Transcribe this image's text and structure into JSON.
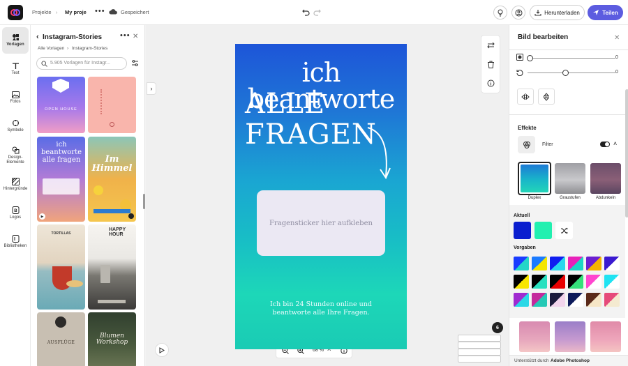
{
  "topbar": {
    "breadcrumb_projects": "Projekte",
    "project_name": "My proje",
    "saved_status": "Gespeichert",
    "download_label": "Herunterladen",
    "share_label": "Teilen",
    "share_color": "#5c5ce0"
  },
  "rail": {
    "items": [
      {
        "label": "Vorlagen",
        "icon": "templates-icon"
      },
      {
        "label": "Text",
        "icon": "text-icon"
      },
      {
        "label": "Fotos",
        "icon": "photos-icon"
      },
      {
        "label": "Symbole",
        "icon": "symbols-icon"
      },
      {
        "label": "Design-Elemente",
        "icon": "design-elements-icon"
      },
      {
        "label": "Hintergründe",
        "icon": "backgrounds-icon"
      },
      {
        "label": "Logos",
        "icon": "logos-icon"
      },
      {
        "label": "Bibliotheken",
        "icon": "libraries-icon"
      }
    ]
  },
  "left_panel": {
    "title": "Instagram-Stories",
    "breadcrumb_all": "Alle Vorlagen",
    "breadcrumb_current": "Instagram-Stories",
    "search_placeholder": "5.905 Vorlagen für Instagr...",
    "templates": {
      "open_house": "OPEN HOUSE",
      "q_title": "ich beantworte alle fragen",
      "himmel": "Im Himmel",
      "tortillas": "TORTILLAS",
      "happy_hour": "HAPPY HOUR",
      "ausfluge": "AUSFLÜGE",
      "blumen": "Blumen Workshop"
    }
  },
  "canvas": {
    "headline_line1": "ich beantworte",
    "headline_line2": "ALLE FRAGEN",
    "sticker_text": "Fragensticker hier aufkleben",
    "footer_text": "Ich bin 24 Stunden online und beantworte alle Ihre Fragen.",
    "zoom": "68 %",
    "page_count": "6"
  },
  "right_panel": {
    "title": "Bild bearbeiten",
    "slider1_value": "0",
    "slider2_value": "0",
    "effects_label": "Effekte",
    "filter_label": "Filter",
    "filter_enabled": true,
    "filters": [
      {
        "label": "Duplex",
        "selected": true
      },
      {
        "label": "Graustufen",
        "selected": false
      },
      {
        "label": "Abdunkeln",
        "selected": false
      }
    ],
    "current_label": "Aktuell",
    "current_colors": [
      "#0a1ecf",
      "#22f0b0"
    ],
    "presets_label": "Vorgaben",
    "presets": [
      [
        "#1a3cff",
        "#24d6c8"
      ],
      [
        "#1a7bff",
        "#f4e600"
      ],
      [
        "#101ef0",
        "#28d6ee"
      ],
      [
        "#e821b9",
        "#1bd6c4"
      ],
      [
        "#6b1fd0",
        "#f5b300"
      ],
      [
        "#3a1ad0",
        "#ffffff"
      ],
      [
        "#000000",
        "#f7e600"
      ],
      [
        "#000000",
        "#29e0c0"
      ],
      [
        "#000000",
        "#e80000"
      ],
      [
        "#000000",
        "#34e07a"
      ],
      [
        "#ff45cf",
        "#ffffff"
      ],
      [
        "#1fe3f2",
        "#ffffff"
      ],
      [
        "#a02bd0",
        "#2ad8e6"
      ],
      [
        "#c42a9c",
        "#25c9b6"
      ],
      [
        "#1c1c3c",
        "#f2d5ec"
      ],
      [
        "#0c1a5a",
        "#ffffff"
      ],
      [
        "#5a2a1a",
        "#f6e6c6"
      ],
      [
        "#e64a7a",
        "#f4ead0"
      ]
    ],
    "powered_by": "Unterstützt durch",
    "powered_brand": "Adobe Photoshop"
  }
}
